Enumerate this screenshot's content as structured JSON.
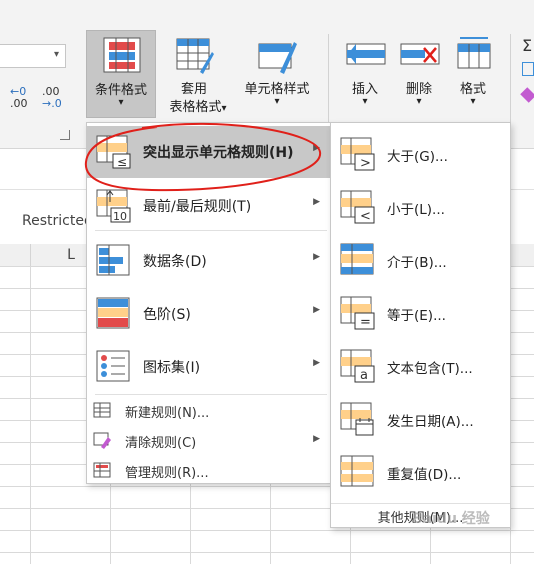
{
  "ribbon": {
    "conditional_format": "条件格式",
    "table_format_line1": "套用",
    "table_format_line2": "表格格式",
    "cell_style": "单元格样式",
    "insert": "插入",
    "delete": "删除",
    "format": "格式",
    "dropdown_arrow": "▾",
    "inc_decimal_top": "←0",
    "inc_decimal_bottom": ".00",
    "dec_decimal_top": ".00",
    "dec_decimal_bottom": "→.0"
  },
  "formula": {
    "name_box_text": "Restricted"
  },
  "grid": {
    "column_label": "L"
  },
  "menu": {
    "items": [
      {
        "label": "突出显示单元格规则(H)",
        "icon": "highlight-rules-icon",
        "highlighted": true
      },
      {
        "label": "最前/最后规则(T)",
        "icon": "top-bottom-rules-icon"
      },
      {
        "label": "数据条(D)",
        "icon": "data-bars-icon"
      },
      {
        "label": "色阶(S)",
        "icon": "color-scales-icon"
      },
      {
        "label": "图标集(I)",
        "icon": "icon-sets-icon"
      }
    ],
    "small_items": [
      {
        "label": "新建规则(N)...",
        "icon": "new-rule-icon"
      },
      {
        "label": "清除规则(C)",
        "icon": "clear-rules-icon"
      },
      {
        "label": "管理规则(R)...",
        "icon": "manage-rules-icon"
      }
    ],
    "arrow": "▶"
  },
  "submenu": {
    "items": [
      {
        "label": "大于(G)...",
        "symbol": ">"
      },
      {
        "label": "小于(L)...",
        "symbol": "<"
      },
      {
        "label": "介于(B)...",
        "symbol": ""
      },
      {
        "label": "等于(E)...",
        "symbol": "="
      },
      {
        "label": "文本包含(T)...",
        "symbol": "a"
      },
      {
        "label": "发生日期(A)...",
        "symbol": ""
      },
      {
        "label": "重复值(D)...",
        "symbol": ""
      }
    ],
    "other": "其他规则(M)..."
  },
  "watermark": "Baidu 经验",
  "colors": {
    "annotation_red": "#e0201a",
    "cf_red": "#e24b4b",
    "bar_blue": "#3d8fd9",
    "cell_yellow": "#ffd08a"
  }
}
